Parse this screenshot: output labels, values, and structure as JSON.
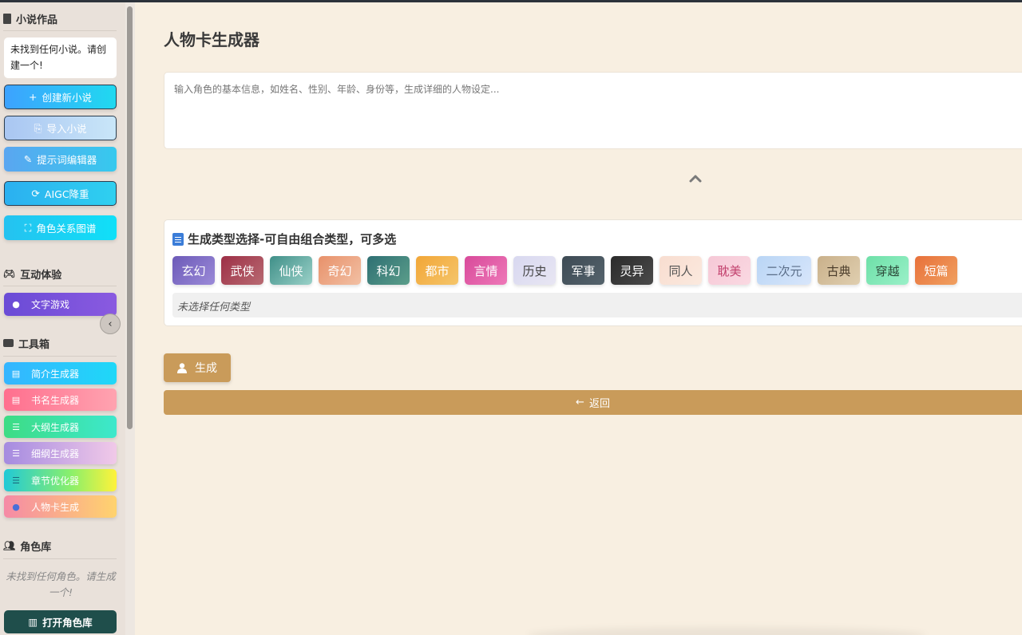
{
  "sidebar": {
    "novels_title": "小说作品",
    "no_novels": "未找到任何小说。请创建一个!",
    "btn_create": "创建新小说",
    "btn_import": "导入小说",
    "btn_prompt": "提示词编辑器",
    "btn_aigc": "AIGC降重",
    "btn_graph": "角色关系图谱",
    "interactive_title": "互动体验",
    "btn_text_game": "文字游戏",
    "toolbox_title": "工具箱",
    "tools": [
      {
        "label": "简介生成器",
        "icon": "file-icon"
      },
      {
        "label": "书名生成器",
        "icon": "file-plus-icon"
      },
      {
        "label": "大纲生成器",
        "icon": "list-icon"
      },
      {
        "label": "细纲生成器",
        "icon": "indent-icon"
      },
      {
        "label": "章节优化器",
        "icon": "bars-icon"
      },
      {
        "label": "人物卡生成",
        "icon": "user-icon"
      }
    ],
    "roles_title": "角色库",
    "no_roles": "未找到任何角色。请生成一个!",
    "btn_open_roles": "打开角色库"
  },
  "main": {
    "title": "人物卡生成器",
    "input_placeholder": "输入角色的基本信息，如姓名、性别、年龄、身份等，生成详细的人物设定...",
    "types_title": "生成类型选择-可自由组合类型，可多选",
    "types": [
      "玄幻",
      "武侠",
      "仙侠",
      "奇幻",
      "科幻",
      "都市",
      "言情",
      "历史",
      "军事",
      "灵异",
      "同人",
      "耽美",
      "二次元",
      "古典",
      "穿越",
      "短篇"
    ],
    "none_selected": "未选择任何类型",
    "btn_generate": "生成",
    "btn_back": "返回"
  },
  "colors": {
    "accent": "#c99b5a",
    "background": "#f8efe1"
  }
}
